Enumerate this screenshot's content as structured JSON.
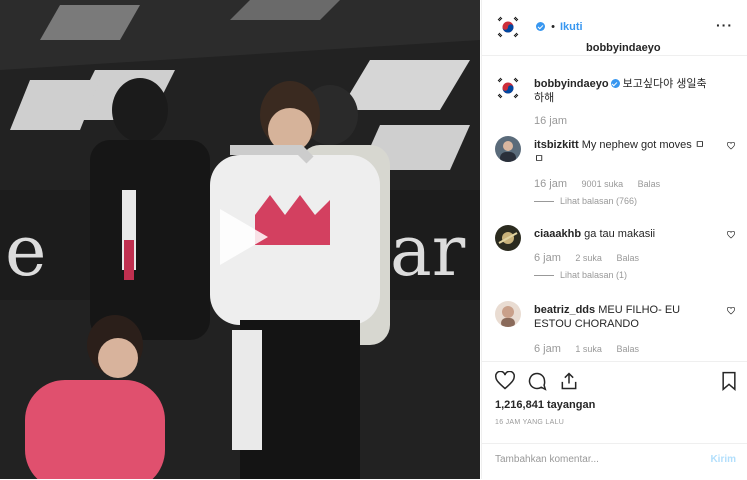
{
  "header": {
    "username": "bobbyindaeyo",
    "separator": "•",
    "follow_label": "Ikuti",
    "more_label": "···"
  },
  "caption": {
    "username": "bobbyindaeyo",
    "text": "보고싶다야 생일축하해",
    "time": "16 jam"
  },
  "comments": [
    {
      "username": "itsbizkitt",
      "text": "My nephew got moves ㅁㅁ",
      "time": "16 jam",
      "likes": "9001 suka",
      "reply": "Balas",
      "replies": "Lihat balasan (766)"
    },
    {
      "username": "ciaaakhb",
      "text": "ga tau makasii",
      "time": "6 jam",
      "likes": "2 suka",
      "reply": "Balas",
      "replies": "Lihat balasan (1)"
    },
    {
      "username": "beatriz_dds",
      "text": "MEU FILHO- EU ESTOU CHORANDO",
      "time": "6 jam",
      "likes": "1 suka",
      "reply": "Balas"
    }
  ],
  "actions": {
    "views": "1,216,841 tayangan",
    "ago": "16 JAM YANG LALU"
  },
  "add_comment": {
    "placeholder": "Tambahkan komentar...",
    "send_label": "Kirim"
  }
}
